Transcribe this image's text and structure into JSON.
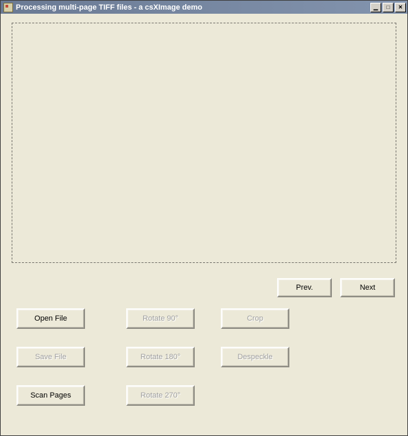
{
  "window": {
    "title": "Processing multi-page TIFF files - a csXImage demo"
  },
  "nav": {
    "prev_label": "Prev.",
    "next_label": "Next"
  },
  "buttons": {
    "open_file": "Open File",
    "save_file": "Save File",
    "scan_pages": "Scan Pages",
    "rotate_90": "Rotate 90°",
    "rotate_180": "Rotate 180°",
    "rotate_270": "Rotate 270°",
    "crop": "Crop",
    "despeckle": "Despeckle"
  },
  "state": {
    "save_file_enabled": false,
    "rotate_90_enabled": false,
    "rotate_180_enabled": false,
    "rotate_270_enabled": false,
    "crop_enabled": false,
    "despeckle_enabled": false
  }
}
